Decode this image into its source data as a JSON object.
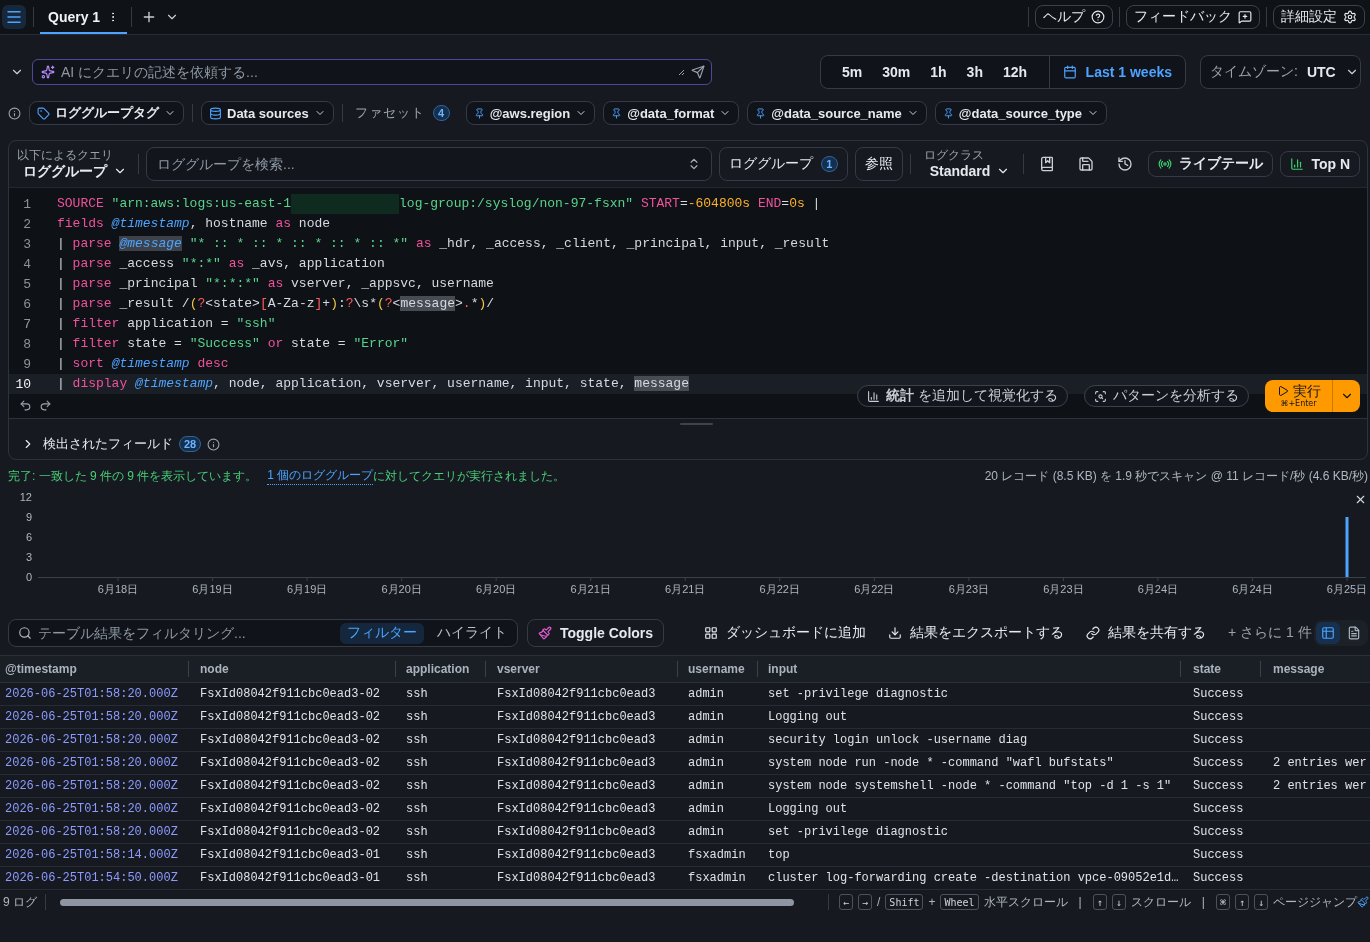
{
  "top_bar": {
    "tabs": [
      {
        "label": "Query 1",
        "selected": true
      }
    ],
    "buttons": [
      {
        "kind": "help",
        "label": "ヘルプ"
      },
      {
        "kind": "feedback",
        "label": "フィードバック"
      },
      {
        "kind": "settings",
        "label": "詳細設定"
      }
    ]
  },
  "ai_prompt": {
    "placeholder": "AI にクエリの記述を依頼する..."
  },
  "time_range": {
    "presets": [
      {
        "label": "5m",
        "selected": false
      },
      {
        "label": "30m",
        "selected": false
      },
      {
        "label": "1h",
        "selected": false
      },
      {
        "label": "3h",
        "selected": false
      },
      {
        "label": "12h",
        "selected": false
      }
    ],
    "custom": {
      "label": "Last 1 weeks",
      "selected": true
    }
  },
  "timezone": {
    "label": "タイムゾーン:",
    "value": "UTC"
  },
  "filters": {
    "log_group_tags": "ロググループタグ",
    "data_sources": "Data sources",
    "facets_label": "ファセット",
    "facets_count": "4",
    "facets": [
      "@aws.region",
      "@data_format",
      "@data_source_name",
      "@data_source_type"
    ]
  },
  "query_bar": {
    "mode_label": "以下によるクエリ",
    "mode": "ロググループ",
    "search_placeholder": "ロググループを検索...",
    "log_groups": "ロググループ",
    "log_groups_count": "1",
    "browse": "参照",
    "log_class_label": "ログクラス",
    "log_class": "Standard",
    "live_tail": "ライブテール",
    "top_n": "Top N"
  },
  "editor": {
    "lines": [
      {
        "number": "1",
        "active": false,
        "tokens": [
          {
            "kind": "kw",
            "text": "SOURCE "
          },
          {
            "kind": "str",
            "text": "\"arn:aws:logs:us-east-1"
          },
          {
            "kind": "redacted"
          },
          {
            "kind": "str",
            "text": "log-group:/syslog/non-97-fsxn\" "
          },
          {
            "kind": "kw",
            "text": "START"
          },
          {
            "kind": "plain",
            "text": "="
          },
          {
            "kind": "num",
            "text": "-604800s "
          },
          {
            "kind": "kw",
            "text": "END"
          },
          {
            "kind": "plain",
            "text": "="
          },
          {
            "kind": "num",
            "text": "0s"
          },
          {
            "kind": "plain",
            "text": " |"
          }
        ]
      },
      {
        "number": "2",
        "active": false,
        "tokens": [
          {
            "kind": "kw",
            "text": "fields "
          },
          {
            "kind": "field",
            "text": "@timestamp"
          },
          {
            "kind": "plain",
            "text": ", hostname "
          },
          {
            "kind": "kw",
            "text": "as"
          },
          {
            "kind": "plain",
            "text": " node"
          }
        ]
      },
      {
        "number": "3",
        "active": false,
        "tokens": [
          {
            "kind": "plain",
            "text": "| "
          },
          {
            "kind": "kw",
            "text": "parse "
          },
          {
            "kind": "field_mark",
            "text": "@message"
          },
          {
            "kind": "str",
            "text": " \"* :: * :: * :: * :: * :: *\""
          },
          {
            "kind": "kw",
            "text": " as"
          },
          {
            "kind": "plain",
            "text": " _hdr, _access, _client, _principal, input, _result"
          }
        ]
      },
      {
        "number": "4",
        "active": false,
        "tokens": [
          {
            "kind": "plain",
            "text": "| "
          },
          {
            "kind": "kw",
            "text": "parse"
          },
          {
            "kind": "plain",
            "text": " _access "
          },
          {
            "kind": "str",
            "text": "\"*:*\""
          },
          {
            "kind": "kw",
            "text": " as"
          },
          {
            "kind": "plain",
            "text": " _avs, application"
          }
        ]
      },
      {
        "number": "5",
        "active": false,
        "tokens": [
          {
            "kind": "plain",
            "text": "| "
          },
          {
            "kind": "kw",
            "text": "parse"
          },
          {
            "kind": "plain",
            "text": " _principal "
          },
          {
            "kind": "str",
            "text": "\"*:*:*\""
          },
          {
            "kind": "kw",
            "text": " as"
          },
          {
            "kind": "plain",
            "text": " vserver, _appsvc, username"
          }
        ]
      },
      {
        "number": "6",
        "active": false,
        "tokens": [
          {
            "kind": "plain",
            "text": "| "
          },
          {
            "kind": "kw",
            "text": "parse"
          },
          {
            "kind": "plain",
            "text": " _result /"
          },
          {
            "kind": "paren",
            "text": "("
          },
          {
            "kind": "regex",
            "text": "?"
          },
          {
            "kind": "plain",
            "text": "<state>"
          },
          {
            "kind": "regex",
            "text": "["
          },
          {
            "kind": "plain",
            "text": "A-Za-z"
          },
          {
            "kind": "regex",
            "text": "]"
          },
          {
            "kind": "plain",
            "text": "+"
          },
          {
            "kind": "paren",
            "text": ")"
          },
          {
            "kind": "plain",
            "text": ":"
          },
          {
            "kind": "regex",
            "text": "?"
          },
          {
            "kind": "plain",
            "text": "\\s*"
          },
          {
            "kind": "paren",
            "text": "("
          },
          {
            "kind": "regex",
            "text": "?"
          },
          {
            "kind": "plain",
            "text": "<"
          },
          {
            "kind": "mark",
            "text": "message"
          },
          {
            "kind": "plain",
            "text": ">"
          },
          {
            "kind": "regex",
            "text": "."
          },
          {
            "kind": "plain",
            "text": "*"
          },
          {
            "kind": "paren",
            "text": ")"
          },
          {
            "kind": "plain",
            "text": "/"
          }
        ]
      },
      {
        "number": "7",
        "active": false,
        "tokens": [
          {
            "kind": "plain",
            "text": "| "
          },
          {
            "kind": "kw",
            "text": "filter"
          },
          {
            "kind": "plain",
            "text": " application = "
          },
          {
            "kind": "str",
            "text": "\"ssh\""
          }
        ]
      },
      {
        "number": "8",
        "active": false,
        "tokens": [
          {
            "kind": "plain",
            "text": "| "
          },
          {
            "kind": "kw",
            "text": "filter"
          },
          {
            "kind": "plain",
            "text": " state = "
          },
          {
            "kind": "str",
            "text": "\"Success\""
          },
          {
            "kind": "kw",
            "text": " or"
          },
          {
            "kind": "plain",
            "text": " state = "
          },
          {
            "kind": "str",
            "text": "\"Error\""
          }
        ]
      },
      {
        "number": "9",
        "active": false,
        "tokens": [
          {
            "kind": "plain",
            "text": "| "
          },
          {
            "kind": "kw",
            "text": "sort "
          },
          {
            "kind": "field",
            "text": "@timestamp"
          },
          {
            "kind": "kw",
            "text": " desc"
          }
        ]
      },
      {
        "number": "10",
        "active": true,
        "tokens": [
          {
            "kind": "plain",
            "text": "| "
          },
          {
            "kind": "kw",
            "text": "display "
          },
          {
            "kind": "field",
            "text": "@timestamp"
          },
          {
            "kind": "plain",
            "text": ", node, application, vserver, username, input, state, "
          },
          {
            "kind": "mark",
            "text": "message"
          }
        ]
      }
    ]
  },
  "editor_actions": {
    "visualize": "**統計** を追加して視覚化する",
    "patterns": "パターンを分析する",
    "run": "実行",
    "run_shortcut": "⌘+Enter"
  },
  "discovered_fields": {
    "label": "検出されたフィールド",
    "count": "28",
    "expanded": false
  },
  "status": {
    "summary": "完了: 一致した 9 件の 9 件を表示しています。",
    "link": "1 個のロググループ",
    "link_suffix": "に対してクエリが実行されました。",
    "stats": "20 レコード (8.5 KB) を 1.9 秒でスキャン @ 11 レコード/秒 (4.6 KB/秒)"
  },
  "histogram": {
    "chart_data": {
      "type": "bar",
      "categories": [
        "6月18日",
        "6月19日",
        "6月19日",
        "6月20日",
        "6月20日",
        "6月21日",
        "6月21日",
        "6月22日",
        "6月22日",
        "6月23日",
        "6月23日",
        "6月24日",
        "6月24日",
        "6月25日"
      ],
      "values": [
        0,
        0,
        0,
        0,
        0,
        0,
        0,
        0,
        0,
        0,
        0,
        0,
        0,
        9
      ],
      "ylim": [
        0,
        12
      ],
      "yticks": [
        0,
        3,
        6,
        9,
        12
      ]
    }
  },
  "table_toolbar": {
    "filter_placeholder": "テーブル結果をフィルタリング...",
    "filter_modes": [
      {
        "label": "フィルター",
        "selected": true
      },
      {
        "label": "ハイライト",
        "selected": false
      }
    ],
    "toggle_colors": "Toggle Colors",
    "actions": [
      {
        "kind": "dashboard",
        "label": "ダッシュボードに追加"
      },
      {
        "kind": "export",
        "label": "結果をエクスポートする"
      },
      {
        "kind": "share",
        "label": "結果を共有する"
      }
    ],
    "more": "+ さらに 1 件",
    "view_modes": [
      {
        "kind": "table",
        "selected": true
      },
      {
        "kind": "text",
        "selected": false
      }
    ]
  },
  "table": {
    "columns": [
      "@timestamp",
      "node",
      "application",
      "vserver",
      "username",
      "input",
      "state",
      "message"
    ],
    "rows": [
      [
        "2026-06-25T01:58:20.000Z",
        "FsxId08042f911cbc0ead3-02",
        "ssh",
        "FsxId08042f911cbc0ead3",
        "admin",
        "set -privilege diagnostic",
        "Success"
      ],
      [
        "2026-06-25T01:58:20.000Z",
        "FsxId08042f911cbc0ead3-02",
        "ssh",
        "FsxId08042f911cbc0ead3",
        "admin",
        "Logging out",
        "Success"
      ],
      [
        "2026-06-25T01:58:20.000Z",
        "FsxId08042f911cbc0ead3-02",
        "ssh",
        "FsxId08042f911cbc0ead3",
        "admin",
        "security login unlock -username diag",
        "Success"
      ],
      [
        "2026-06-25T01:58:20.000Z",
        "FsxId08042f911cbc0ead3-02",
        "ssh",
        "FsxId08042f911cbc0ead3",
        "admin",
        "system node run -node * -command \"wafl bufstats\"",
        "Success",
        "2 entries wer"
      ],
      [
        "2026-06-25T01:58:20.000Z",
        "FsxId08042f911cbc0ead3-02",
        "ssh",
        "FsxId08042f911cbc0ead3",
        "admin",
        "system node systemshell -node * -command \"top -d 1 -s 1\"",
        "Success",
        "2 entries wer"
      ],
      [
        "2026-06-25T01:58:20.000Z",
        "FsxId08042f911cbc0ead3-02",
        "ssh",
        "FsxId08042f911cbc0ead3",
        "admin",
        "Logging out",
        "Success"
      ],
      [
        "2026-06-25T01:58:20.000Z",
        "FsxId08042f911cbc0ead3-02",
        "ssh",
        "FsxId08042f911cbc0ead3",
        "admin",
        "set -privilege diagnostic",
        "Success"
      ],
      [
        "2026-06-25T01:58:14.000Z",
        "FsxId08042f911cbc0ead3-01",
        "ssh",
        "FsxId08042f911cbc0ead3",
        "fsxadmin",
        "top",
        "Success"
      ],
      [
        "2026-06-25T01:54:50.000Z",
        "FsxId08042f911cbc0ead3-01",
        "ssh",
        "FsxId08042f911cbc0ead3",
        "fsxadmin",
        "cluster log-forwarding create -destination vpce-09052e1d…",
        "Success"
      ]
    ]
  },
  "footer": {
    "count": "9 ログ",
    "hints": [
      {
        "kind": "key",
        "text": "←"
      },
      {
        "kind": "key",
        "text": "→"
      },
      {
        "kind": "text",
        "text": "/"
      },
      {
        "kind": "key",
        "text": "Shift"
      },
      {
        "kind": "text",
        "text": "+"
      },
      {
        "kind": "key",
        "text": "Wheel"
      },
      {
        "kind": "text",
        "text": "水平スクロール"
      },
      {
        "kind": "divider",
        "text": "|"
      },
      {
        "kind": "key",
        "text": "↑"
      },
      {
        "kind": "key",
        "text": "↓"
      },
      {
        "kind": "text",
        "text": "スクロール"
      },
      {
        "kind": "divider",
        "text": "|"
      },
      {
        "kind": "key",
        "text": "⌘"
      },
      {
        "kind": "key",
        "text": "↑"
      },
      {
        "kind": "key",
        "text": "↓"
      },
      {
        "kind": "text",
        "text": "ページジャンプ"
      }
    ]
  }
}
